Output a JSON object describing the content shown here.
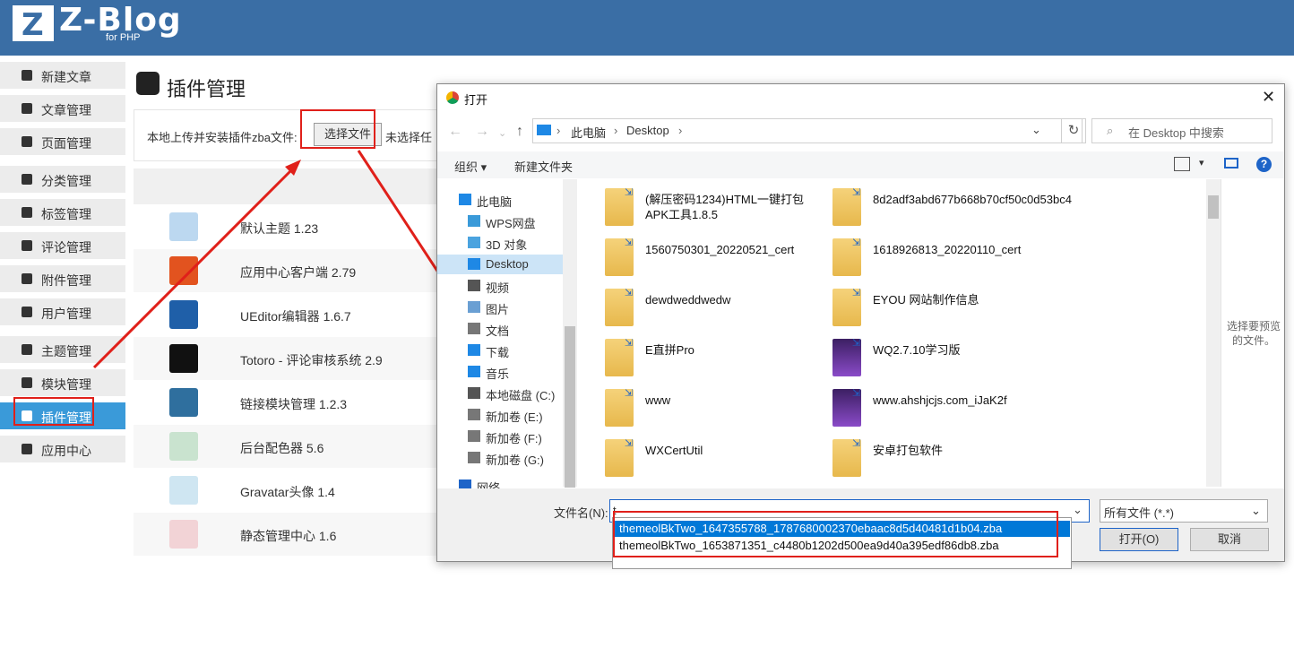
{
  "header": {
    "logo_letter": "Z",
    "logo_text": "Z-Blog",
    "logo_sub": "for PHP"
  },
  "sidebar": {
    "items": [
      {
        "label": "新建文章"
      },
      {
        "label": "文章管理"
      },
      {
        "label": "页面管理"
      },
      {
        "label": "分类管理"
      },
      {
        "label": "标签管理"
      },
      {
        "label": "评论管理"
      },
      {
        "label": "附件管理"
      },
      {
        "label": "用户管理"
      },
      {
        "label": "主题管理"
      },
      {
        "label": "模块管理"
      },
      {
        "label": "插件管理"
      },
      {
        "label": "应用中心"
      }
    ],
    "active": "插件管理"
  },
  "main": {
    "title": "插件管理",
    "upload_label": "本地上传并安装插件zba文件:",
    "choose_file": "选择文件",
    "no_file": "未选择任",
    "plugins": [
      {
        "name": "默认主题 1.23",
        "color": "#bcd8f0"
      },
      {
        "name": "应用中心客户端 2.79",
        "color": "#e2531f"
      },
      {
        "name": "UEditor编辑器 1.6.7",
        "color": "#1f5fa8"
      },
      {
        "name": "Totoro - 评论审核系统 2.9",
        "color": "#111111"
      },
      {
        "name": "链接模块管理 1.2.3",
        "color": "#2f6f9e"
      },
      {
        "name": "后台配色器 5.6",
        "color": "#c9e3cf"
      },
      {
        "name": "Gravatar头像 1.4",
        "color": "#cfe6f2"
      },
      {
        "name": "静态管理中心 1.6",
        "color": "#f2d3d6"
      }
    ]
  },
  "dialog": {
    "title": "打开",
    "close": "✕",
    "address": [
      "此电脑",
      "Desktop"
    ],
    "search_placeholder": "在 Desktop 中搜索",
    "toolbar": {
      "organize": "组织 ▾",
      "new_folder": "新建文件夹",
      "help": "?"
    },
    "nav_items": [
      {
        "label": "此电脑"
      },
      {
        "label": "WPS网盘"
      },
      {
        "label": "3D 对象"
      },
      {
        "label": "Desktop"
      },
      {
        "label": "视频"
      },
      {
        "label": "图片"
      },
      {
        "label": "文档"
      },
      {
        "label": "下载"
      },
      {
        "label": "音乐"
      },
      {
        "label": "本地磁盘 (C:)"
      },
      {
        "label": "新加卷 (E:)"
      },
      {
        "label": "新加卷 (F:)"
      },
      {
        "label": "新加卷 (G:)"
      },
      {
        "label": "网络"
      }
    ],
    "nav_selected": "Desktop",
    "files": [
      {
        "name": "(解压密码1234)HTML一键打包APK工具1.8.5",
        "type": "folder"
      },
      {
        "name": "8d2adf3abd677b668b70cf50c0d53bc4",
        "type": "folder"
      },
      {
        "name": "1560750301_20220521_cert",
        "type": "folder"
      },
      {
        "name": "1618926813_20220110_cert",
        "type": "folder"
      },
      {
        "name": "dewdweddwedw",
        "type": "folder"
      },
      {
        "name": "EYOU 网站制作信息",
        "type": "folder"
      },
      {
        "name": "E直拼Pro",
        "type": "folder"
      },
      {
        "name": "WQ2.7.10学习版",
        "type": "ps"
      },
      {
        "name": "www",
        "type": "folder"
      },
      {
        "name": "www.ahshjcjs.com_iJaK2f",
        "type": "ps"
      },
      {
        "name": "WXCertUtil",
        "type": "folder"
      },
      {
        "name": "安卓打包软件",
        "type": "folder"
      }
    ],
    "preview_text": "选择要预览的文件。",
    "filename_label": "文件名(N):",
    "filename_value": "t",
    "filetype": "所有文件 (*.*)",
    "open_btn": "打开(O)",
    "cancel_btn": "取消",
    "suggestions": [
      "themeolBkTwo_1647355788_1787680002370ebaac8d5d40481d1b04.zba",
      "themeolBkTwo_1653871351_c4480b1202d500ea9d40a395edf86db8.zba"
    ]
  }
}
